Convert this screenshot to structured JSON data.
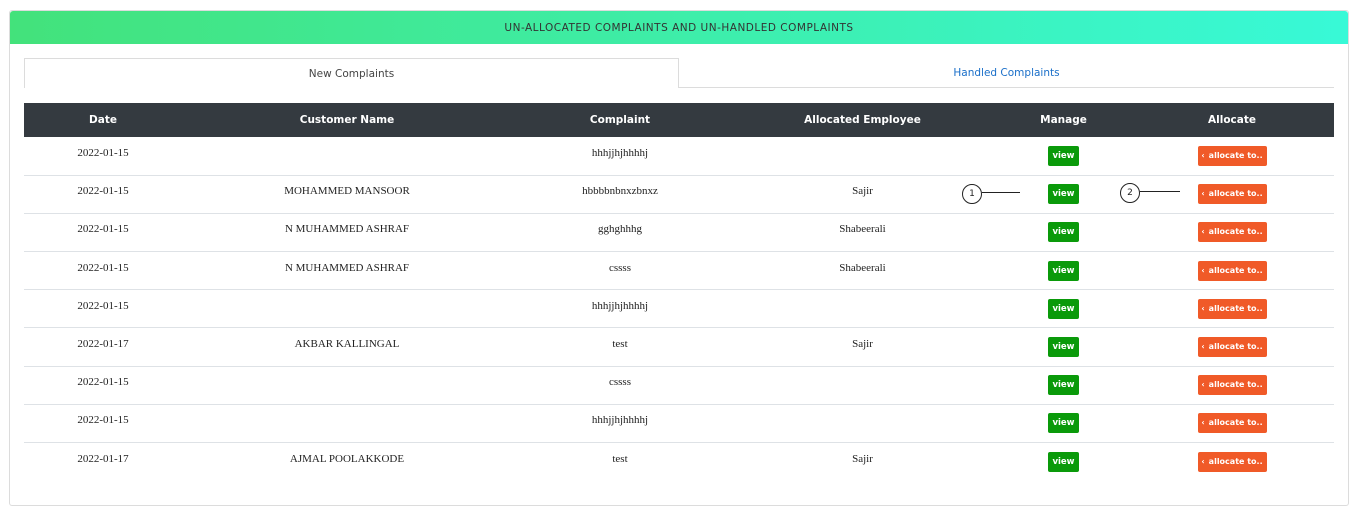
{
  "header": {
    "title": "UN-ALLOCATED COMPLAINTS AND UN-HANDLED COMPLAINTS"
  },
  "tabs": [
    {
      "label": "New Complaints"
    },
    {
      "label": "Handled Complaints"
    }
  ],
  "table": {
    "columns": [
      "Date",
      "Customer Name",
      "Complaint",
      "Allocated Employee",
      "Manage",
      "Allocate"
    ],
    "rows": [
      {
        "date": "2022-01-15",
        "customer": "",
        "complaint": "hhhjjhjhhhhj",
        "employee": "",
        "view": "view",
        "allocate": "allocate to.."
      },
      {
        "date": "2022-01-15",
        "customer": "MOHAMMED MANSOOR",
        "complaint": "hbbbbnbnxzbnxz",
        "employee": "Sajir",
        "view": "view",
        "allocate": "allocate to.."
      },
      {
        "date": "2022-01-15",
        "customer": "N MUHAMMED ASHRAF",
        "complaint": "gghghhhg",
        "employee": "Shabeerali",
        "view": "view",
        "allocate": "allocate to.."
      },
      {
        "date": "2022-01-15",
        "customer": "N MUHAMMED ASHRAF",
        "complaint": "cssss",
        "employee": "Shabeerali",
        "view": "view",
        "allocate": "allocate to.."
      },
      {
        "date": "2022-01-15",
        "customer": "",
        "complaint": "hhhjjhjhhhhj",
        "employee": "",
        "view": "view",
        "allocate": "allocate to.."
      },
      {
        "date": "2022-01-17",
        "customer": "AKBAR KALLINGAL",
        "complaint": "test",
        "employee": "Sajir",
        "view": "view",
        "allocate": "allocate to.."
      },
      {
        "date": "2022-01-15",
        "customer": "",
        "complaint": "cssss",
        "employee": "",
        "view": "view",
        "allocate": "allocate to.."
      },
      {
        "date": "2022-01-15",
        "customer": "",
        "complaint": "hhhjjhjhhhhj",
        "employee": "",
        "view": "view",
        "allocate": "allocate to.."
      },
      {
        "date": "2022-01-17",
        "customer": "AJMAL POOLAKKODE",
        "complaint": "test",
        "employee": "Sajir",
        "view": "view",
        "allocate": "allocate to.."
      }
    ]
  },
  "annotations": [
    {
      "label": "1"
    },
    {
      "label": "2"
    }
  ],
  "colors": {
    "header_gradient_start": "#43e27b",
    "header_gradient_end": "#38f9d7",
    "table_header_bg": "#343a40",
    "view_button": "#0a9a0a",
    "allocate_button": "#f05a28",
    "link": "#1a6fc9"
  }
}
